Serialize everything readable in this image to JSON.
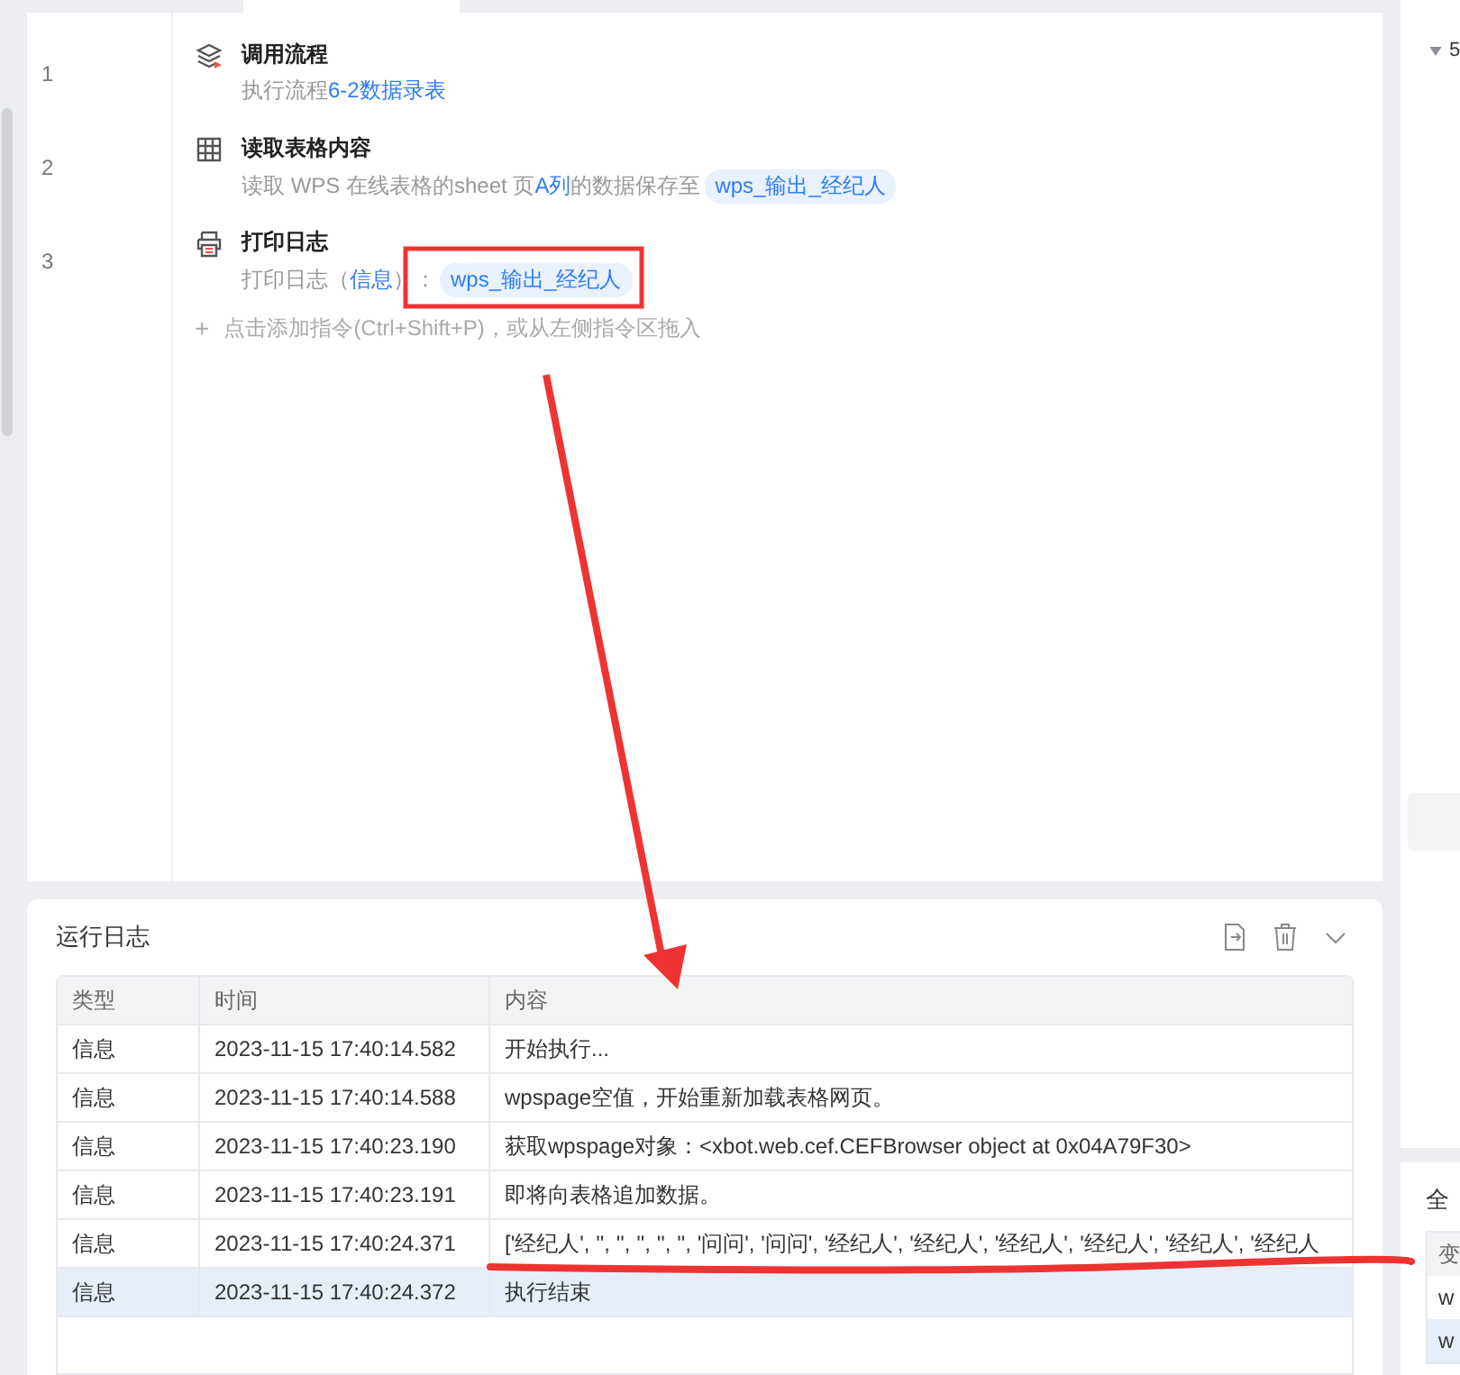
{
  "steps": [
    {
      "number": "1",
      "kind": "flow",
      "title": "调用流程",
      "parts": [
        {
          "text": "执行流程",
          "link": false
        },
        {
          "text": "6-2数据录表",
          "link": true
        }
      ]
    },
    {
      "number": "2",
      "kind": "table",
      "title": "读取表格内容",
      "parts": [
        {
          "text": "读取 WPS 在线表格的sheet 页",
          "link": false
        },
        {
          "text": "A列",
          "link": true
        },
        {
          "text": "的数据保存至",
          "link": false
        }
      ],
      "tag": "wps_输出_经纪人"
    },
    {
      "number": "3",
      "kind": "print",
      "title": "打印日志",
      "parts": [
        {
          "text": "打印日志（",
          "link": false
        },
        {
          "text": "信息",
          "link": true
        },
        {
          "text": "）：",
          "link": false
        }
      ],
      "tag": "wps_输出_经纪人"
    }
  ],
  "add_icon": "+",
  "add_hint": "点击添加指令(Ctrl+Shift+P)，或从左侧指令区拖入",
  "log": {
    "title": "运行日志",
    "columns": [
      "类型",
      "时间",
      "内容"
    ],
    "rows": [
      {
        "type": "信息",
        "time": "2023-11-15 17:40:14.582",
        "content": "开始执行...",
        "selected": false
      },
      {
        "type": "信息",
        "time": "2023-11-15 17:40:14.588",
        "content": "wpspage空值，开始重新加载表格网页。",
        "selected": false
      },
      {
        "type": "信息",
        "time": "2023-11-15 17:40:23.190",
        "content": "获取wpspage对象：<xbot.web.cef.CEFBrowser object at 0x04A79F30>",
        "selected": false
      },
      {
        "type": "信息",
        "time": "2023-11-15 17:40:23.191",
        "content": "即将向表格追加数据。",
        "selected": false
      },
      {
        "type": "信息",
        "time": "2023-11-15 17:40:24.371",
        "content": "['经纪人', '', '', '', '', '', '问问', '问问', '经纪人', '经纪人', '经纪人', '经纪人', '经纪人', '经纪人",
        "selected": false
      },
      {
        "type": "信息",
        "time": "2023-11-15 17:40:24.372",
        "content": "执行结束",
        "selected": true
      }
    ]
  },
  "side": {
    "tree_label": "5",
    "section_title": "全",
    "column": "变",
    "rows": [
      {
        "text": "w",
        "selected": false
      },
      {
        "text": "w",
        "selected": true
      }
    ]
  }
}
